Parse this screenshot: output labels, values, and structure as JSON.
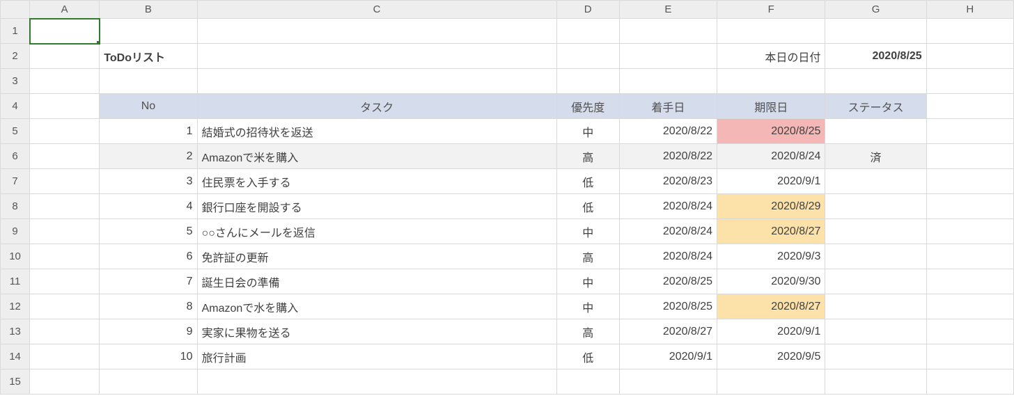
{
  "columns": [
    "A",
    "B",
    "C",
    "D",
    "E",
    "F",
    "G",
    "H"
  ],
  "rowNumbers": [
    "1",
    "2",
    "3",
    "4",
    "5",
    "6",
    "7",
    "8",
    "9",
    "10",
    "11",
    "12",
    "13",
    "14",
    "15"
  ],
  "title": "ToDoリスト",
  "todayLabel": "本日の日付",
  "todayValue": "2020/8/25",
  "headers": {
    "no": "No",
    "task": "タスク",
    "priority": "優先度",
    "start": "着手日",
    "due": "期限日",
    "status": "ステータス"
  },
  "tasks": [
    {
      "no": "1",
      "task": "結婚式の招待状を返送",
      "priority": "中",
      "start": "2020/8/22",
      "due": "2020/8/25",
      "status": "",
      "dueHighlight": "red"
    },
    {
      "no": "2",
      "task": "Amazonで米を購入",
      "priority": "高",
      "start": "2020/8/22",
      "due": "2020/8/24",
      "status": "済",
      "dueHighlight": "",
      "stripe": true
    },
    {
      "no": "3",
      "task": "住民票を入手する",
      "priority": "低",
      "start": "2020/8/23",
      "due": "2020/9/1",
      "status": "",
      "dueHighlight": ""
    },
    {
      "no": "4",
      "task": "銀行口座を開設する",
      "priority": "低",
      "start": "2020/8/24",
      "due": "2020/8/29",
      "status": "",
      "dueHighlight": "yellow"
    },
    {
      "no": "5",
      "task": "○○さんにメールを返信",
      "priority": "中",
      "start": "2020/8/24",
      "due": "2020/8/27",
      "status": "",
      "dueHighlight": "yellow"
    },
    {
      "no": "6",
      "task": "免許証の更新",
      "priority": "高",
      "start": "2020/8/24",
      "due": "2020/9/3",
      "status": "",
      "dueHighlight": ""
    },
    {
      "no": "7",
      "task": "誕生日会の準備",
      "priority": "中",
      "start": "2020/8/25",
      "due": "2020/9/30",
      "status": "",
      "dueHighlight": ""
    },
    {
      "no": "8",
      "task": "Amazonで水を購入",
      "priority": "中",
      "start": "2020/8/25",
      "due": "2020/8/27",
      "status": "",
      "dueHighlight": "yellow"
    },
    {
      "no": "9",
      "task": "実家に果物を送る",
      "priority": "高",
      "start": "2020/8/27",
      "due": "2020/9/1",
      "status": "",
      "dueHighlight": ""
    },
    {
      "no": "10",
      "task": "旅行計画",
      "priority": "低",
      "start": "2020/9/1",
      "due": "2020/9/5",
      "status": "",
      "dueHighlight": ""
    }
  ]
}
